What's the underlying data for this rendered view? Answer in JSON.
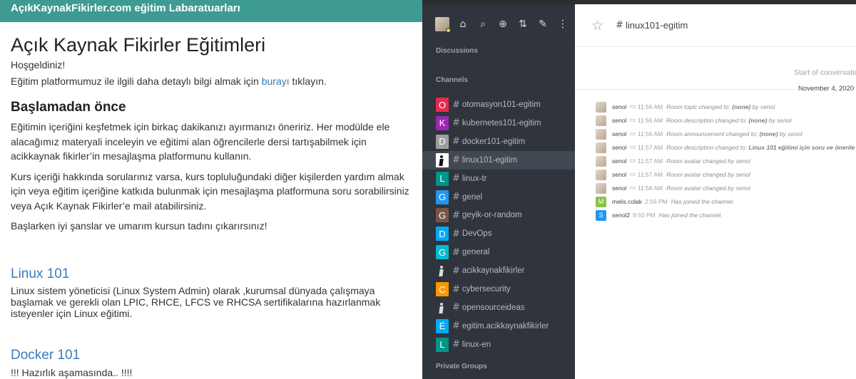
{
  "site": {
    "header_title": "AçıkKaynakFikirler.com eğitim Labaratuarları",
    "page_title": "Açık Kaynak Fikirler Eğitimleri",
    "greeting": "Hoşgeldiniz!",
    "info_prefix": "Eğitim platformumuz ile ilgili daha detaylı bilgi almak için ",
    "info_link": "burayı",
    "info_suffix": " tıklayın.",
    "before_start_heading": "Başlamadan önce",
    "para1": "Eğitimin içeriğini keşfetmek için birkaç dakikanızı ayırmanızı öneririz. Her modülde ele alacağımız materyali inceleyin ve eğitimi alan öğrencilerle dersi tartışabilmek için acikkaynak fikirler’in mesajlaşma platformunu kullanın.",
    "para2": "Kurs içeriği hakkında sorularınız varsa, kurs topluluğundaki diğer kişilerden yardım almak için veya eğitim içeriğine katkıda bulunmak için mesajlaşma platformuna soru sorabilirsiniz veya Açık Kaynak Fikirler’e mail atabilirsiniz.",
    "para3": "Başlarken iyi şanslar ve umarım kursun tadını çıkarırsınız!",
    "course1_title": "Linux 101",
    "course1_desc": "Linux sistem yöneticisi (Linux System Admin) olarak ,kurumsal dünyada çalışmaya başlamak ve gerekli olan LPIC, RHCE, LFCS ve RHCSA sertifikalarına hazırlanmak isteyenler için Linux eğitimi.",
    "course2_title": "Docker 101",
    "course2_desc": "!!! Hazırlık aşamasında.. !!!!"
  },
  "chat": {
    "toolbar_icons": [
      "home-icon",
      "search-icon",
      "directory-icon",
      "sort-icon",
      "edit-icon",
      "menu-icon"
    ],
    "sections": {
      "discussions": "Discussions",
      "channels": "Channels",
      "private_groups": "Private Groups"
    },
    "channels": [
      {
        "letter": "O",
        "color": "#e52a50",
        "name": "otomasyon101-egitim"
      },
      {
        "letter": "K",
        "color": "#9c27b0",
        "name": "kubernetes101-egitim"
      },
      {
        "letter": "D",
        "color": "#9e9e9e",
        "name": "docker101-egitim"
      },
      {
        "letter": "",
        "color": "#ffffff",
        "name": "linux101-egitim",
        "active": true
      },
      {
        "letter": "L",
        "color": "#009688",
        "name": "linux-tr"
      },
      {
        "letter": "G",
        "color": "#2196f3",
        "name": "genel"
      },
      {
        "letter": "G",
        "color": "#795548",
        "name": "geyik-or-random"
      },
      {
        "letter": "D",
        "color": "#03a9f4",
        "name": "DevOps"
      },
      {
        "letter": "G",
        "color": "#00bcd4",
        "name": "general"
      },
      {
        "letter": "",
        "color": "#2f343d",
        "name": "acikkaynakfikirler"
      },
      {
        "letter": "C",
        "color": "#ff9800",
        "name": "cybersecurity"
      },
      {
        "letter": "",
        "color": "#2f343d",
        "name": "opensourceideas"
      },
      {
        "letter": "E",
        "color": "#03a9f4",
        "name": "egitim.acikkaynakfikirler"
      },
      {
        "letter": "L",
        "color": "#009688",
        "name": "linux-en"
      }
    ],
    "room": {
      "name": "linux101-egitim",
      "start_text": "Start of conversation",
      "date": "November 4, 2020",
      "messages": [
        {
          "user": "senol",
          "time": "11:56 AM",
          "text": "Room topic changed to: ",
          "bold": "(none)",
          "tail": " by senol"
        },
        {
          "user": "senol",
          "time": "11:56 AM",
          "text": "Room description changed to: ",
          "bold": "(none)",
          "tail": " by senol"
        },
        {
          "user": "senol",
          "time": "11:56 AM",
          "text": "Room announcement changed to: ",
          "bold": "(none)",
          "tail": " by senol"
        },
        {
          "user": "senol",
          "time": "11:57 AM",
          "text": "Room description changed to: ",
          "bold": "Linux 101 eğitimi için soru ve önerile",
          "tail": ""
        },
        {
          "user": "senol",
          "time": "11:57 AM",
          "text": "Room avatar changed by senol",
          "bold": "",
          "tail": ""
        },
        {
          "user": "senol",
          "time": "11:57 AM",
          "text": "Room avatar changed by senol",
          "bold": "",
          "tail": ""
        },
        {
          "user": "senol",
          "time": "11:58 AM",
          "text": "Room avatar changed by senol",
          "bold": "",
          "tail": ""
        },
        {
          "user": "melis.colak",
          "avatar_letter": "M",
          "avatar_color": "#8bc34a",
          "time": "2:56 PM",
          "text": "Has joined the channel.",
          "bold": "",
          "tail": ""
        },
        {
          "user": "senol2",
          "avatar_letter": "S",
          "avatar_color": "#2196f3",
          "time": "9:50 PM",
          "text": "Has joined the channel.",
          "bold": "",
          "tail": ""
        }
      ]
    }
  }
}
